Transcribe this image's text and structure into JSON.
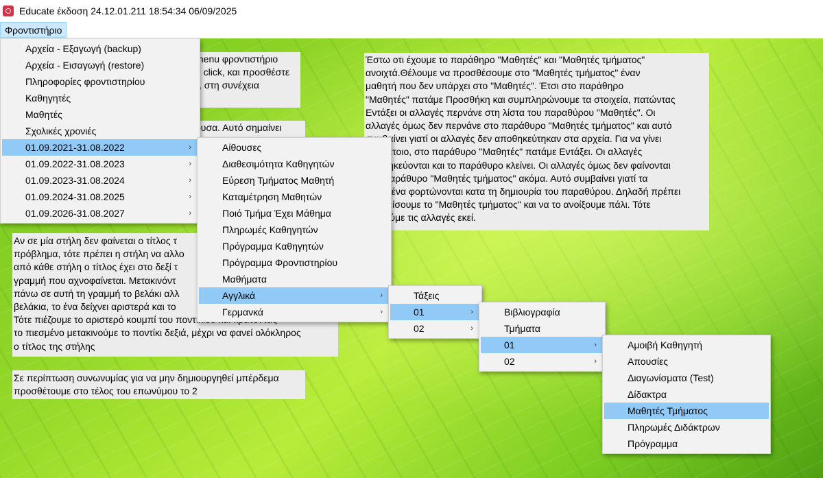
{
  "window": {
    "title": "Educate έκδοση 24.12.01.211 18:54:34 06/09/2025"
  },
  "menubar": {
    "item": "Φροντιστήριο"
  },
  "notes": {
    "n1": [
      "menu φροντιστήριο",
      "e click, και προσθέστε",
      "\", στη συνέχεια"
    ],
    "n2": [
      "ουσα. Αυτό σημαίνει"
    ],
    "n3": [
      "Αν σε μία στήλη δεν φαίνεται ο τίτλος τ",
      "πρόβλημα, τότε πρέπει η στήλη να αλλο",
      "από κάθε στήλη ο τίτλος έχει στο δεξί τ",
      "γραμμή που αχνοφαίνεται. Μετακινόντ",
      "πάνω σε αυτή τη γραμμή το βελάκι αλλ",
      "βελάκια, το ένα δείχνει αριστερά και το",
      "Τότε πιέζουμε το αριστερό κουμπί του ποντικιού και κρατόντας",
      "το πιεσμένο μετακινούμε το ποντίκι δεξιά, μέχρι να φανεί ολόκληρος",
      "ο τίτλος της στήλης"
    ],
    "n4": [
      "Σε περίπτωση συνωνυμίας για να μην δημιουργηθεί μπέρδεμα",
      "προσθέτουμε στο τέλος του επωνύμου το 2"
    ],
    "n5": [
      "Έστω οτι έχουμε το παράθηρο \"Μαθητές\" και \"Μαθητές τμήματος\"",
      "ανοιχτά.Θέλουμε να προσθέσουμε στο \"Μαθητές τμήματος\" έναν",
      "μαθητή που δεν υπάρχει στο \"Μαθητές\". Έτσι στο παράθηρο",
      "\"Μαθητές\" πατάμε Προσθήκη και συμπληρώνουμε τα στοιχεία, πατώντας",
      "Εντάξει οι αλλαγές περνάνε στη λίστα του παραθύρου \"Μαθητές\". Οι",
      "αλλαγές όμως δεν περνάνε στο παράθυρο \"Μαθητές τμήματος\" και αυτό",
      "συμβαίνει γιατί οι αλλαγές δεν αποθηκεύτηκαν στα αρχεία. Για να γίνει",
      "κάτι τέτοιο, στο παράθυρο \"Μαθητές\" πατάμε Εντάξει. Οι αλλαγές",
      "αποθηκεύονται και το παράθυρο κλείνει. Οι αλλαγές όμως δεν φαίνονται",
      "στο παράθυρο \"Μαθητές τμήματος\" ακόμα. Αυτό συμβαίνει γιατί τα",
      "δεδομένα φορτώνονται κατα τη δημιουρία του παραθύρου. Δηλαδή πρέπει",
      "να κλείσουμε το \"Μαθητές τμήματος\" και να το ανοίξουμε πάλι. Τότε",
      "θα δούμε τις αλλαγές εκεί."
    ]
  },
  "menu1": [
    {
      "label": "Αρχεία - Εξαγωγή (backup)",
      "arrow": ""
    },
    {
      "label": "Αρχεία - Εισαγωγή (restore)",
      "arrow": ""
    },
    {
      "label": "Πληροφορίες φροντιστηρίου",
      "arrow": ""
    },
    {
      "label": "Καθηγητές",
      "arrow": ""
    },
    {
      "label": "Μαθητές",
      "arrow": ""
    },
    {
      "label": "Σχολικές χρονιές",
      "arrow": ""
    },
    {
      "label": "01.09.2021-31.08.2022",
      "arrow": "›"
    },
    {
      "label": "01.09.2022-31.08.2023",
      "arrow": "›"
    },
    {
      "label": "01.09.2023-31.08.2024",
      "arrow": "›"
    },
    {
      "label": "01.09.2024-31.08.2025",
      "arrow": "›"
    },
    {
      "label": "01.09.2026-31.08.2027",
      "arrow": "›"
    }
  ],
  "menu2": [
    {
      "label": "Αίθουσες",
      "arrow": ""
    },
    {
      "label": "Διαθεσιμότητα Καθηγητών",
      "arrow": ""
    },
    {
      "label": "Εύρεση Τμήματος Μαθητή",
      "arrow": ""
    },
    {
      "label": "Καταμέτρηση Μαθητών",
      "arrow": ""
    },
    {
      "label": "Ποιό Τμήμα Έχει Μάθημα",
      "arrow": ""
    },
    {
      "label": "Πληρωμές Καθηγητών",
      "arrow": ""
    },
    {
      "label": "Πρόγραμμα Καθηγητών",
      "arrow": ""
    },
    {
      "label": "Πρόγραμμα Φροντιστηρίου",
      "arrow": ""
    },
    {
      "label": "Μαθήματα",
      "arrow": ""
    },
    {
      "label": "Αγγλικά",
      "arrow": "›"
    },
    {
      "label": "Γερμανκά",
      "arrow": "›"
    }
  ],
  "menu3": [
    {
      "label": "Τάξεις",
      "arrow": ""
    },
    {
      "label": "01",
      "arrow": "›"
    },
    {
      "label": "02",
      "arrow": "›"
    }
  ],
  "menu4": [
    {
      "label": "Βιβλιογραφία",
      "arrow": ""
    },
    {
      "label": "Τμήματα",
      "arrow": ""
    },
    {
      "label": "01",
      "arrow": "›"
    },
    {
      "label": "02",
      "arrow": "›"
    }
  ],
  "menu5": [
    {
      "label": "Αμοιβή Καθηγητή",
      "arrow": ""
    },
    {
      "label": "Απουσίες",
      "arrow": ""
    },
    {
      "label": "Διαγωνίσματα (Test)",
      "arrow": ""
    },
    {
      "label": "Δίδακτρα",
      "arrow": ""
    },
    {
      "label": "Μαθητές Τμήματος",
      "arrow": ""
    },
    {
      "label": "Πληρωμές Διδάκτρων",
      "arrow": ""
    },
    {
      "label": "Πρόγραμμα",
      "arrow": ""
    }
  ]
}
